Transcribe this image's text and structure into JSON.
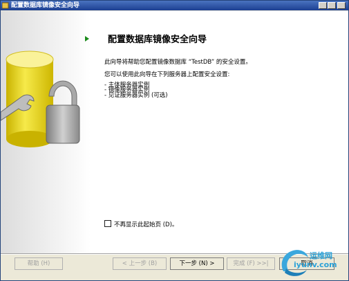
{
  "window": {
    "title": "配置数据库镜像安全向导",
    "icon": "wizard-app-icon"
  },
  "content": {
    "heading": "配置数据库镜像安全向导",
    "intro": "此向导将帮助您配置镜像数据库 “TestDB” 的安全设置。",
    "instances_intro": "您可以使用此向导在下列服务器上配置安全设置:",
    "instances": [
      "- 主体服务器实例",
      "- 镜像服务器实例",
      "- 见证服务器实例 (可选)"
    ],
    "dont_show_label": "不再显示此起始页 (D)。",
    "dont_show_checked": false,
    "art": "database-lock-wrench-illustration"
  },
  "buttons": {
    "help": "帮助 (H)",
    "back": "< 上一步 (B)",
    "next": "下一步 (N) >",
    "finish": "完成 (F) >>|",
    "cancel": "取消"
  },
  "watermark": {
    "line1": "运维网",
    "line2": "iyunv.com"
  },
  "colors": {
    "titlebar": "#1c3f91",
    "arrow": "#1a8a1a",
    "watermark": "#2aa1d8"
  }
}
